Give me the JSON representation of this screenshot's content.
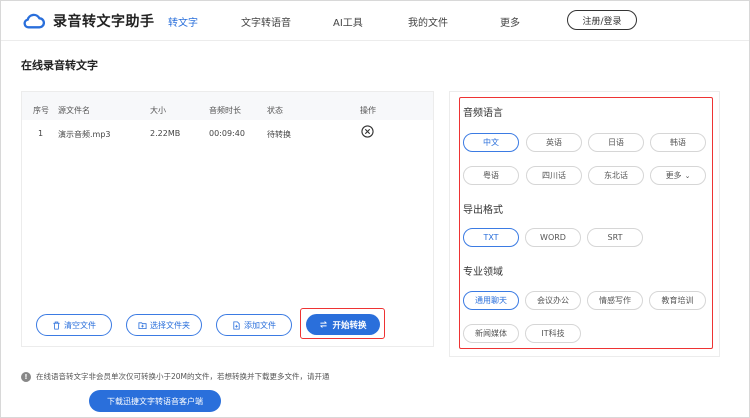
{
  "brand": {
    "name": "录音转文字助手",
    "accent": "#2a6fdb",
    "highlight": "#e33333"
  },
  "nav": {
    "items": [
      "转文字",
      "文字转语音",
      "AI工具",
      "我的文件",
      "更多"
    ],
    "active_index": 0,
    "login_label": "注册/登录"
  },
  "page_title": "在线录音转文字",
  "file_table": {
    "headers": [
      "序号",
      "源文件名",
      "大小",
      "音频时长",
      "状态",
      "操作"
    ],
    "rows": [
      {
        "index": "1",
        "name": "演示音频.mp3",
        "size": "2.22MB",
        "duration": "00:09:40",
        "status": "待转换",
        "action_icon": "close-circle-icon"
      }
    ]
  },
  "actions": {
    "clear": {
      "label": "清空文件",
      "icon": "trash-icon"
    },
    "select_folder": {
      "label": "选择文件夹",
      "icon": "folder-icon"
    },
    "add_file": {
      "label": "添加文件",
      "icon": "add-file-icon"
    },
    "start": {
      "label": "开始转换",
      "icon": "convert-icon"
    }
  },
  "options": {
    "language": {
      "title": "音频语言",
      "items": [
        "中文",
        "英语",
        "日语",
        "韩语",
        "粤语",
        "四川话",
        "东北话",
        "更多"
      ],
      "selected": "中文"
    },
    "format": {
      "title": "导出格式",
      "items": [
        "TXT",
        "WORD",
        "SRT"
      ],
      "selected": "TXT"
    },
    "domain": {
      "title": "专业领域",
      "items": [
        "通用聊天",
        "会议办公",
        "情感写作",
        "教育培训",
        "新闻媒体",
        "IT科技"
      ],
      "selected": "通用聊天"
    }
  },
  "footer": {
    "notice": "在线语音转文字非会员单次仅可转换小于20M的文件，若想转换并下载更多文件，请开通",
    "notice_icon": "info-icon",
    "download_label": "下载迅捷文字转语音客户端"
  }
}
